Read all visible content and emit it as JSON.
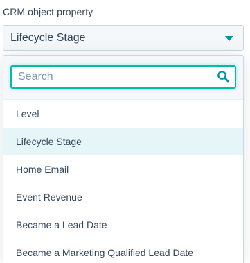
{
  "field": {
    "label": "CRM object property",
    "selected_value": "Lifecycle Stage"
  },
  "search": {
    "placeholder": "Search",
    "value": ""
  },
  "options": [
    {
      "label": "Level",
      "selected": false
    },
    {
      "label": "Lifecycle Stage",
      "selected": true
    },
    {
      "label": "Home Email",
      "selected": false
    },
    {
      "label": "Event Revenue",
      "selected": false
    },
    {
      "label": "Became a Lead Date",
      "selected": false
    },
    {
      "label": "Became a Marketing Qualified Lead Date",
      "selected": false
    }
  ],
  "colors": {
    "accent": "#0091ae",
    "focus_border": "#00bda5",
    "selected_bg": "#e5f5f8",
    "text": "#33475b"
  },
  "icons": {
    "caret": "chevron-down-icon",
    "search": "search-icon"
  }
}
